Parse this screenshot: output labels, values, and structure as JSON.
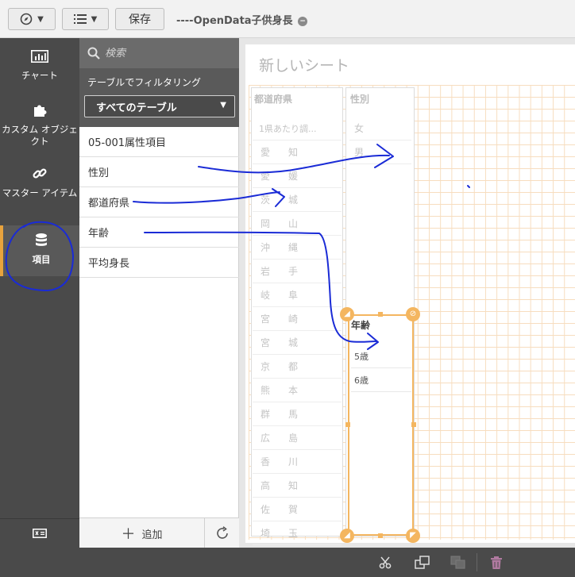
{
  "toolbar": {
    "save_label": "保存",
    "app_title": "----OpenData子供身長"
  },
  "leftbar": {
    "items": [
      {
        "label": "チャート",
        "icon": "bar-chart-icon"
      },
      {
        "label": "カスタム オブジェクト",
        "icon": "puzzle-icon"
      },
      {
        "label": "マスター アイテム",
        "icon": "link-icon"
      },
      {
        "label": "項目",
        "icon": "database-icon",
        "active": true
      }
    ],
    "bottom_icon": "card-icon"
  },
  "panel": {
    "search_placeholder": "検索",
    "filter_label": "テーブルでフィルタリング",
    "filter_value": "すべてのテーブル",
    "fields": [
      "05-001属性項目",
      "性別",
      "都道府県",
      "年齢",
      "平均身長"
    ],
    "add_label": "追加"
  },
  "sheet": {
    "title": "新しいシート",
    "prefecture_list": {
      "title": "都道府県",
      "rows": [
        [
          "1県あたり調...",
          ""
        ],
        [
          "愛",
          "知"
        ],
        [
          "愛",
          "媛"
        ],
        [
          "茨",
          "城"
        ],
        [
          "岡",
          "山"
        ],
        [
          "沖",
          "縄"
        ],
        [
          "岩",
          "手"
        ],
        [
          "岐",
          "阜"
        ],
        [
          "宮",
          "崎"
        ],
        [
          "宮",
          "城"
        ],
        [
          "京",
          "都"
        ],
        [
          "熊",
          "本"
        ],
        [
          "群",
          "馬"
        ],
        [
          "広",
          "島"
        ],
        [
          "香",
          "川"
        ],
        [
          "高",
          "知"
        ],
        [
          "佐",
          "賀"
        ],
        [
          "埼",
          "玉"
        ]
      ]
    },
    "gender_list": {
      "title": "性別",
      "rows": [
        "女",
        "男"
      ]
    },
    "age_list": {
      "title": "年齢",
      "rows": [
        "5歳",
        "6歳"
      ]
    }
  },
  "colors": {
    "accent": "#f4b660",
    "active_marker": "#e8a33d",
    "annotation_ink": "#1a2bd6",
    "sidebar": "#4a4a4a"
  }
}
